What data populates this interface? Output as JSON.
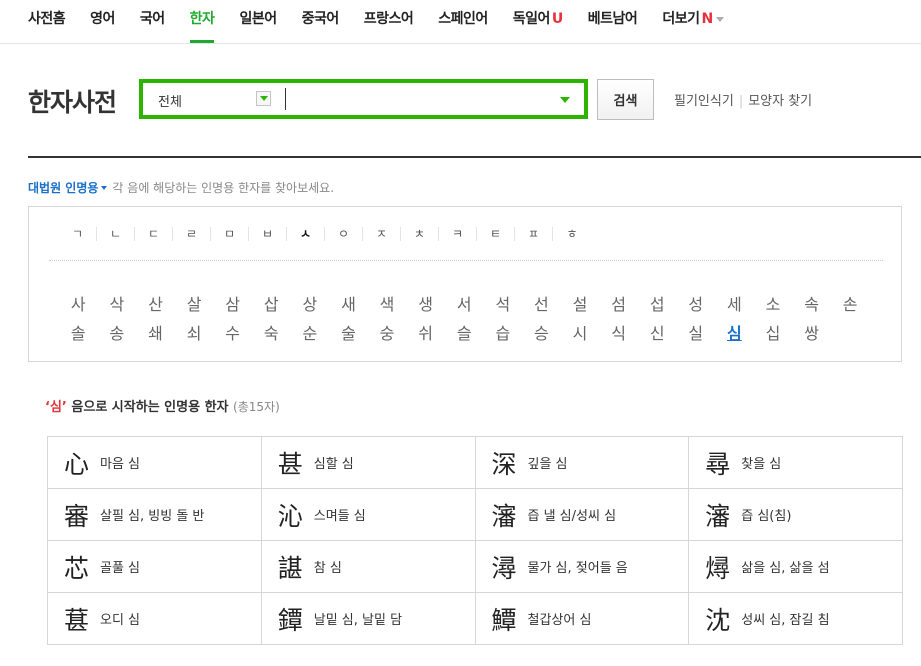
{
  "nav": {
    "items": [
      {
        "label": "사전홈",
        "active": false
      },
      {
        "label": "영어",
        "active": false
      },
      {
        "label": "국어",
        "active": false
      },
      {
        "label": "한자",
        "active": true
      },
      {
        "label": "일본어",
        "active": false
      },
      {
        "label": "중국어",
        "active": false
      },
      {
        "label": "프랑스어",
        "active": false
      },
      {
        "label": "스페인어",
        "active": false
      },
      {
        "label": "독일어",
        "active": false,
        "suffix": "U"
      },
      {
        "label": "베트남어",
        "active": false
      },
      {
        "label": "더보기",
        "active": false,
        "suffix": "N"
      }
    ]
  },
  "search": {
    "title": "한자사전",
    "scope": "전체",
    "query": "",
    "button_label": "검색",
    "link_handwriting": "필기인식기",
    "link_shape": "모양자 찾기"
  },
  "dict": {
    "name": "대법원 인명용",
    "description": "각 음에 해당하는 인명용 한자를 찾아보세요."
  },
  "consonants": [
    "ㄱ",
    "ㄴ",
    "ㄷ",
    "ㄹ",
    "ㅁ",
    "ㅂ",
    "ㅅ",
    "ㅇ",
    "ㅈ",
    "ㅊ",
    "ㅋ",
    "ㅌ",
    "ㅍ",
    "ㅎ"
  ],
  "selected_consonant": "ㅅ",
  "syllables": [
    "사",
    "삭",
    "산",
    "살",
    "삼",
    "삽",
    "상",
    "새",
    "색",
    "생",
    "서",
    "석",
    "선",
    "설",
    "섬",
    "섭",
    "성",
    "세",
    "소",
    "속",
    "손",
    "솔",
    "송",
    "쇄",
    "쇠",
    "수",
    "숙",
    "순",
    "술",
    "숭",
    "쉬",
    "슬",
    "습",
    "승",
    "시",
    "식",
    "신",
    "실",
    "심",
    "십",
    "쌍"
  ],
  "selected_syllable": "심",
  "results": {
    "query": "심",
    "heading": "음으로 시작하는 인명용 한자",
    "count_text": "(총15자)",
    "items": [
      {
        "hanja": "心",
        "meaning": "마음 심"
      },
      {
        "hanja": "甚",
        "meaning": "심할 심"
      },
      {
        "hanja": "深",
        "meaning": "깊을 심"
      },
      {
        "hanja": "尋",
        "meaning": "찾을 심"
      },
      {
        "hanja": "審",
        "meaning": "살필 심, 빙빙 돌 반"
      },
      {
        "hanja": "沁",
        "meaning": "스며들 심"
      },
      {
        "hanja": "瀋",
        "meaning": "즙 낼 심/성씨 심"
      },
      {
        "hanja": "瀋",
        "meaning": "즙 심(침)"
      },
      {
        "hanja": "芯",
        "meaning": "골풀 심"
      },
      {
        "hanja": "諶",
        "meaning": "참 심"
      },
      {
        "hanja": "潯",
        "meaning": "물가 심, 젖어들 음"
      },
      {
        "hanja": "燖",
        "meaning": "삶을 심, 삶을 섬"
      },
      {
        "hanja": "葚",
        "meaning": "오디 심"
      },
      {
        "hanja": "鐔",
        "meaning": "날밑 심, 날밑 담"
      },
      {
        "hanja": "鱏",
        "meaning": "철갑상어 심"
      },
      {
        "hanja": "沈",
        "meaning": "성씨 심, 잠길 침"
      }
    ]
  }
}
